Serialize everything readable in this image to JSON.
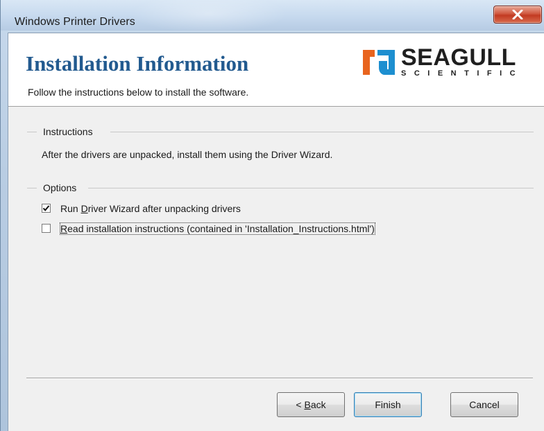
{
  "window": {
    "title": "Windows Printer Drivers"
  },
  "header": {
    "title": "Installation Information",
    "subtitle": "Follow the instructions below to install the software.",
    "logo": {
      "word": "SEAGULL",
      "sub": "SCIENTIFIC",
      "color": "#1f1f1f"
    }
  },
  "instructions": {
    "group_label": "Instructions",
    "text": "After the drivers are unpacked, install them using the Driver Wizard."
  },
  "options": {
    "group_label": "Options",
    "items": [
      {
        "label_prefix": "Run ",
        "label_accel": "D",
        "label_rest": "river Wizard after unpacking drivers",
        "checked": true
      },
      {
        "label_prefix": "",
        "label_accel": "R",
        "label_rest": "ead installation instructions (contained in 'Installation_Instructions.html')",
        "checked": false
      }
    ]
  },
  "buttons": {
    "back_prefix": "< ",
    "back_accel": "B",
    "back_rest": "ack",
    "finish": "Finish",
    "cancel": "Cancel"
  },
  "colors": {
    "title_blue": "#225a8f",
    "close_red": "#c23a22",
    "dialog_bg": "#f0f0f0"
  }
}
